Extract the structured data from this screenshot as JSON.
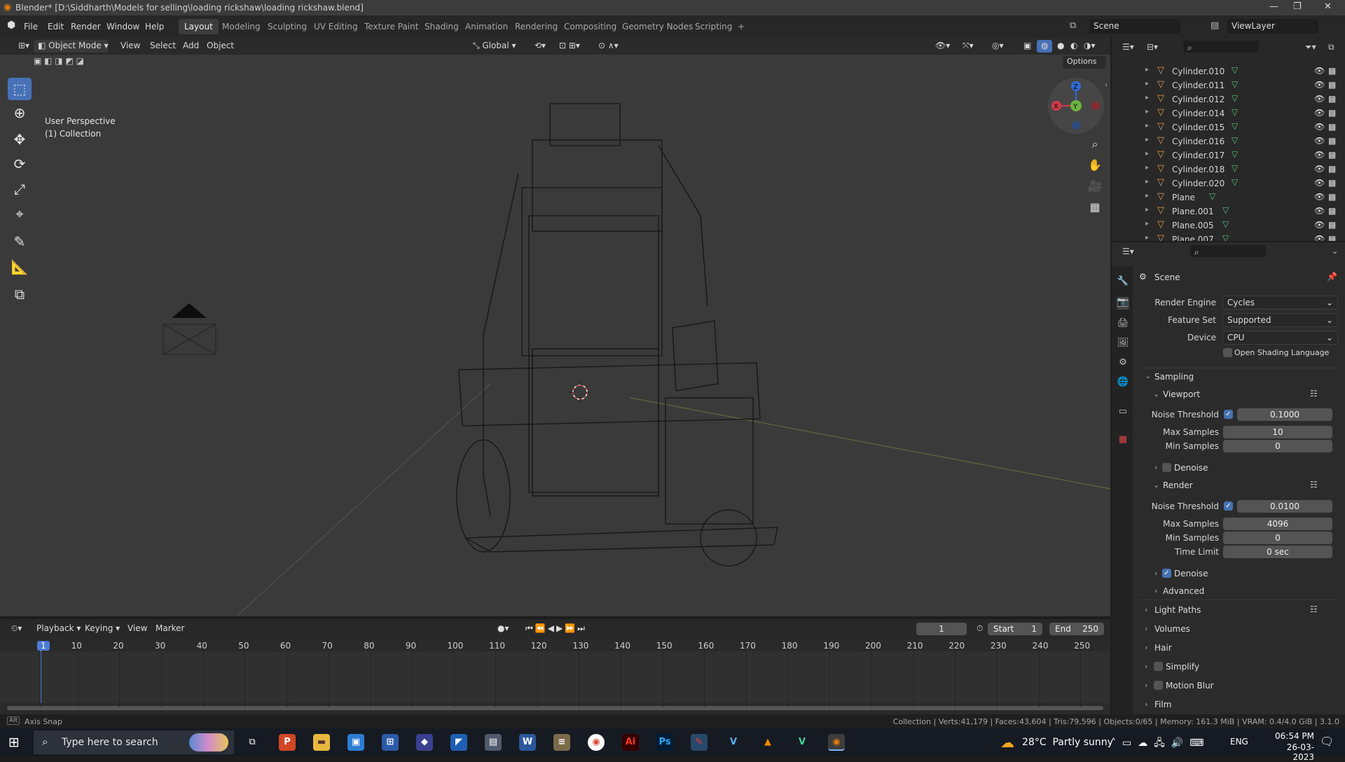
{
  "window": {
    "title": "Blender* [D:\\Siddharth\\Models for selling\\loading rickshaw\\loading rickshaw.blend]",
    "controls": [
      "—",
      "❐",
      "✕"
    ]
  },
  "menu": {
    "items": [
      "File",
      "Edit",
      "Render",
      "Window",
      "Help"
    ],
    "workspaces": [
      "Layout",
      "Modeling",
      "Sculpting",
      "UV Editing",
      "Texture Paint",
      "Shading",
      "Animation",
      "Rendering",
      "Compositing",
      "Geometry Nodes",
      "Scripting"
    ],
    "active_workspace": "Layout",
    "add_tab": "+",
    "scene_name": "Scene",
    "view_layer": "ViewLayer"
  },
  "viewport_header": {
    "mode": "Object Mode",
    "menus": [
      "View",
      "Select",
      "Add",
      "Object"
    ],
    "transform_orientation": "Global",
    "options": "Options"
  },
  "viewport": {
    "perspective_label": "User Perspective",
    "collection_label": "(1) Collection",
    "gizmo_axes": {
      "x": "X",
      "y": "Y",
      "z": "Z"
    }
  },
  "toolbar": {
    "tools": [
      "select-box",
      "cursor",
      "move",
      "rotate",
      "scale",
      "transform",
      "annotate",
      "measure",
      "add-cube"
    ]
  },
  "outliner": {
    "rows": [
      {
        "name": "Cylinder.010"
      },
      {
        "name": "Cylinder.011"
      },
      {
        "name": "Cylinder.012"
      },
      {
        "name": "Cylinder.014"
      },
      {
        "name": "Cylinder.015"
      },
      {
        "name": "Cylinder.016"
      },
      {
        "name": "Cylinder.017"
      },
      {
        "name": "Cylinder.018"
      },
      {
        "name": "Cylinder.020"
      },
      {
        "name": "Plane"
      },
      {
        "name": "Plane.001"
      },
      {
        "name": "Plane.005"
      },
      {
        "name": "Plane.007"
      }
    ]
  },
  "properties": {
    "context": "Scene",
    "render_engine": {
      "label": "Render Engine",
      "value": "Cycles"
    },
    "feature_set": {
      "label": "Feature Set",
      "value": "Supported"
    },
    "device": {
      "label": "Device",
      "value": "CPU"
    },
    "osl": {
      "label": "Open Shading Language",
      "checked": false
    },
    "sampling": {
      "title": "Sampling",
      "viewport": {
        "title": "Viewport",
        "noise_threshold_label": "Noise Threshold",
        "noise_threshold": "0.1000",
        "max_samples_label": "Max Samples",
        "max_samples": "10",
        "min_samples_label": "Min Samples",
        "min_samples": "0",
        "denoise_label": "Denoise",
        "denoise": false
      },
      "render": {
        "title": "Render",
        "noise_threshold_label": "Noise Threshold",
        "noise_threshold": "0.0100",
        "max_samples_label": "Max Samples",
        "max_samples": "4096",
        "min_samples_label": "Min Samples",
        "min_samples": "0",
        "time_limit_label": "Time Limit",
        "time_limit": "0 sec",
        "denoise_label": "Denoise",
        "denoise": true
      },
      "advanced": "Advanced"
    },
    "panels": [
      "Light Paths",
      "Volumes",
      "Hair",
      "Simplify",
      "Motion Blur",
      "Film"
    ]
  },
  "timeline": {
    "menus": [
      "Playback",
      "Keying",
      "View",
      "Marker"
    ],
    "current_frame": "1",
    "start_label": "Start",
    "start": "1",
    "end_label": "End",
    "end": "250",
    "ticks": [
      "1",
      "10",
      "20",
      "30",
      "40",
      "50",
      "60",
      "70",
      "80",
      "90",
      "100",
      "110",
      "120",
      "130",
      "140",
      "150",
      "160",
      "170",
      "180",
      "190",
      "200",
      "210",
      "220",
      "230",
      "240",
      "250"
    ]
  },
  "statusbar": {
    "left": "Axis Snap",
    "right": "Collection | Verts:41,179 | Faces:43,604 | Tris:79,596 | Objects:0/65 | Memory: 161.3 MiB | VRAM: 0.4/4.0 GiB | 3.1.0"
  },
  "taskbar": {
    "search_placeholder": "Type here to search",
    "weather": "28°C  Partly sunny",
    "lang": "ENG",
    "time": "06:54 PM",
    "date": "26-03-2023"
  }
}
